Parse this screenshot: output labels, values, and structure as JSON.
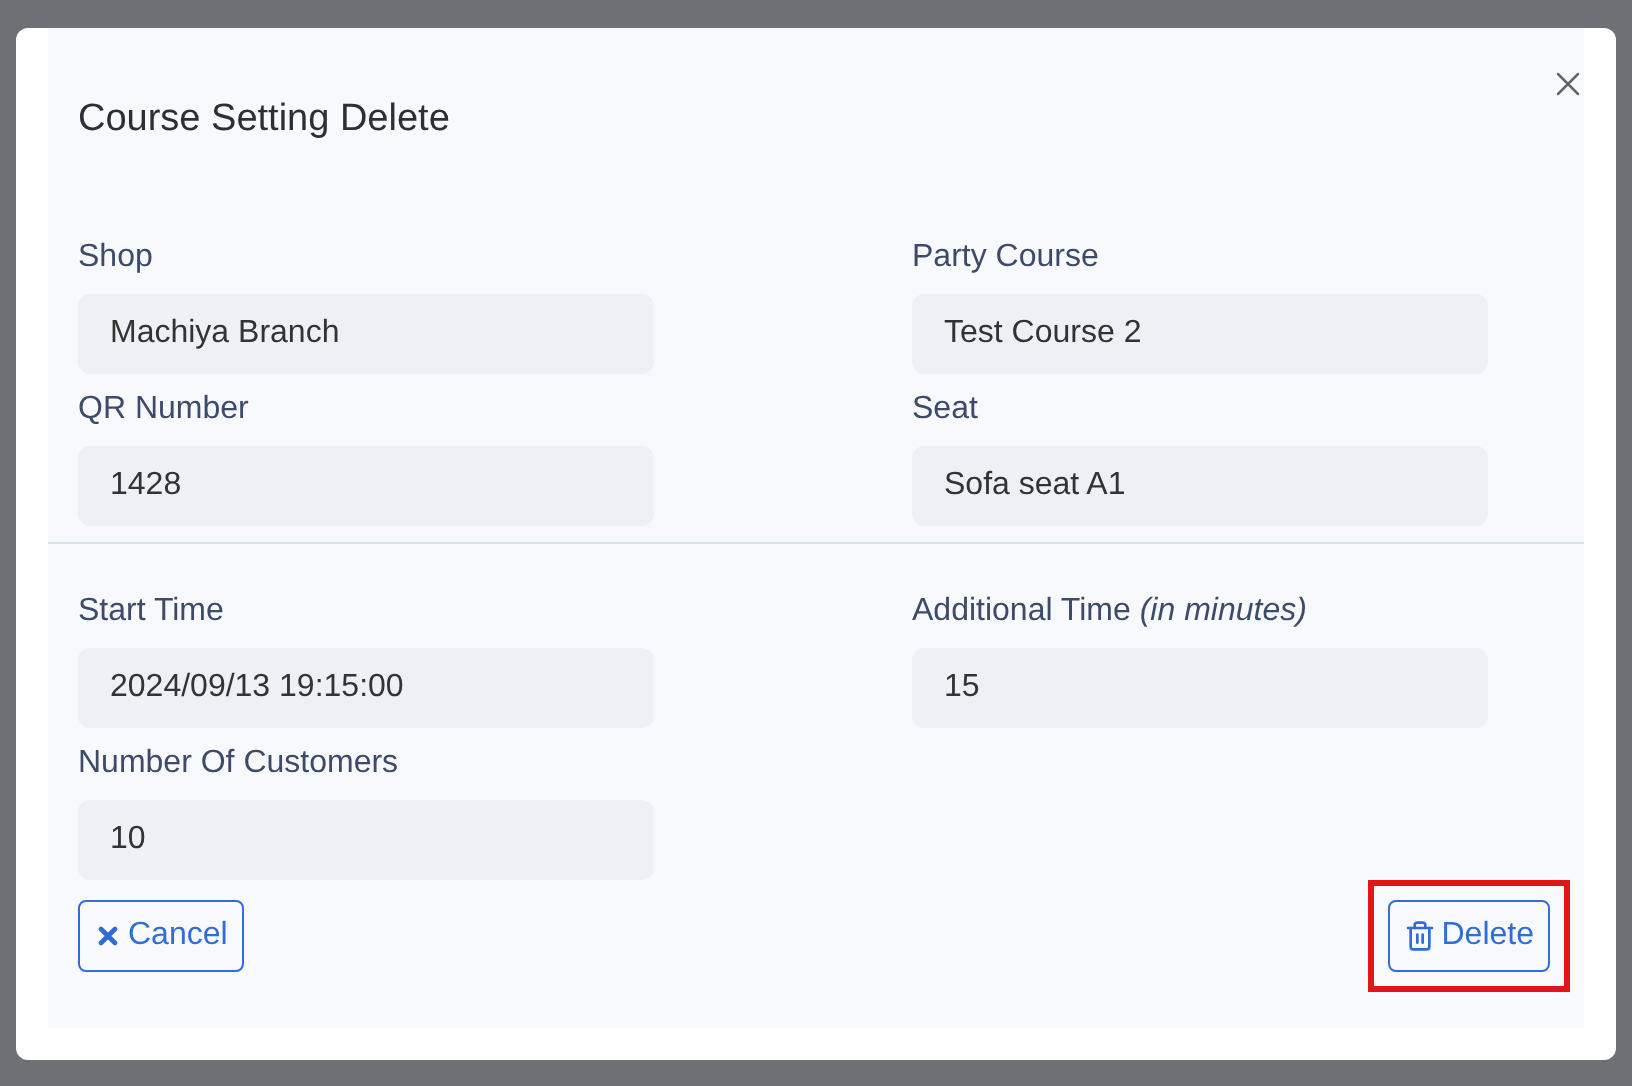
{
  "dialog": {
    "title": "Course Setting Delete"
  },
  "sections": [
    {
      "fields": [
        {
          "label": "Shop",
          "value": "Machiya Branch"
        },
        {
          "label": "Party Course",
          "value": "Test Course 2"
        },
        {
          "label": "QR Number",
          "value": "1428"
        },
        {
          "label": "Seat",
          "value": "Sofa seat A1"
        }
      ]
    },
    {
      "fields": [
        {
          "label": "Start Time",
          "value": "2024/09/13 19:15:00"
        },
        {
          "label": "Additional Time *(in minutes)*",
          "value": "15"
        },
        {
          "label": "Number Of Customers",
          "value": "10"
        }
      ]
    }
  ],
  "buttons": [
    {
      "kind": "cancel",
      "label": "Cancel",
      "highlighted": false
    },
    {
      "kind": "delete",
      "label": "Delete",
      "highlighted": true
    }
  ]
}
